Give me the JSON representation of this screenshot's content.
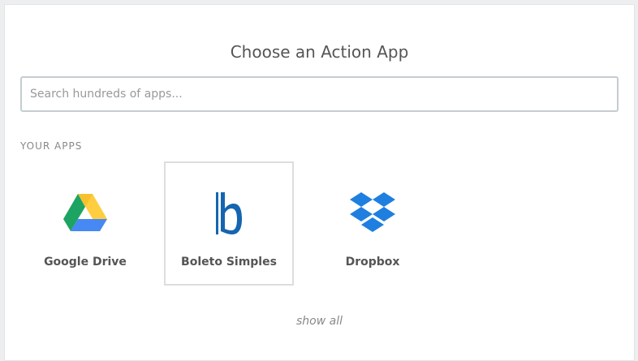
{
  "header": {
    "title": "Choose an Action App"
  },
  "search": {
    "placeholder": "Search hundreds of apps..."
  },
  "section": {
    "label": "YOUR APPS"
  },
  "apps": [
    {
      "name": "Google Drive",
      "icon": "google-drive-icon",
      "selected": false
    },
    {
      "name": "Boleto Simples",
      "icon": "boleto-simples-icon",
      "selected": true
    },
    {
      "name": "Dropbox",
      "icon": "dropbox-icon",
      "selected": false
    }
  ],
  "footer": {
    "show_all": "show all"
  },
  "colors": {
    "dropbox_blue": "#1f7fe0",
    "boleto_blue": "#1565b0",
    "gdrive_green": "#1da462",
    "gdrive_yellow": "#ffcd40",
    "gdrive_blue": "#4688f4"
  }
}
